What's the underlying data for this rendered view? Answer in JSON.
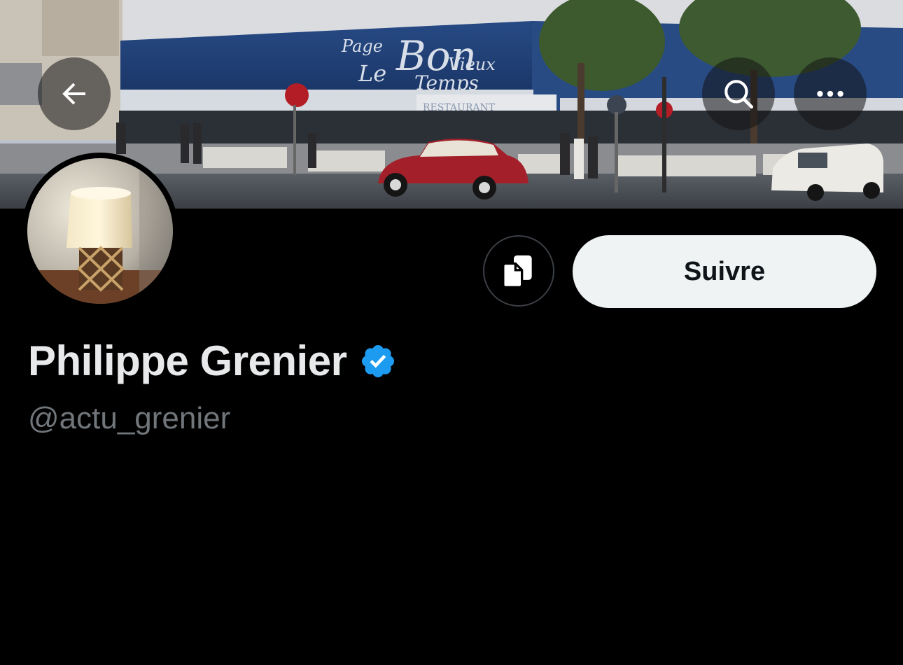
{
  "banner": {
    "image_name": "vintage-street-restaurant-photo",
    "sign_lines": [
      "Page",
      "Bon",
      "Vieux",
      "Le",
      "Temps"
    ],
    "awning_text": "RESTAURANT"
  },
  "header": {
    "back_icon": "arrow-left-icon",
    "search_icon": "search-icon",
    "more_icon": "more-horizontal-icon"
  },
  "profile": {
    "avatar_image": "table-lamp-photo",
    "display_name": "Philippe Grenier",
    "verified_icon": "verified-badge-icon",
    "handle": "@actu_grenier"
  },
  "actions": {
    "copy_icon": "copy-icon",
    "follow_label": "Suivre"
  },
  "colors": {
    "background": "#000000",
    "name_text": "#e7e9ea",
    "handle_text": "#71767b",
    "follow_bg": "#eff3f4",
    "follow_text": "#0f1419",
    "verified_blue": "#1d9bf0"
  }
}
